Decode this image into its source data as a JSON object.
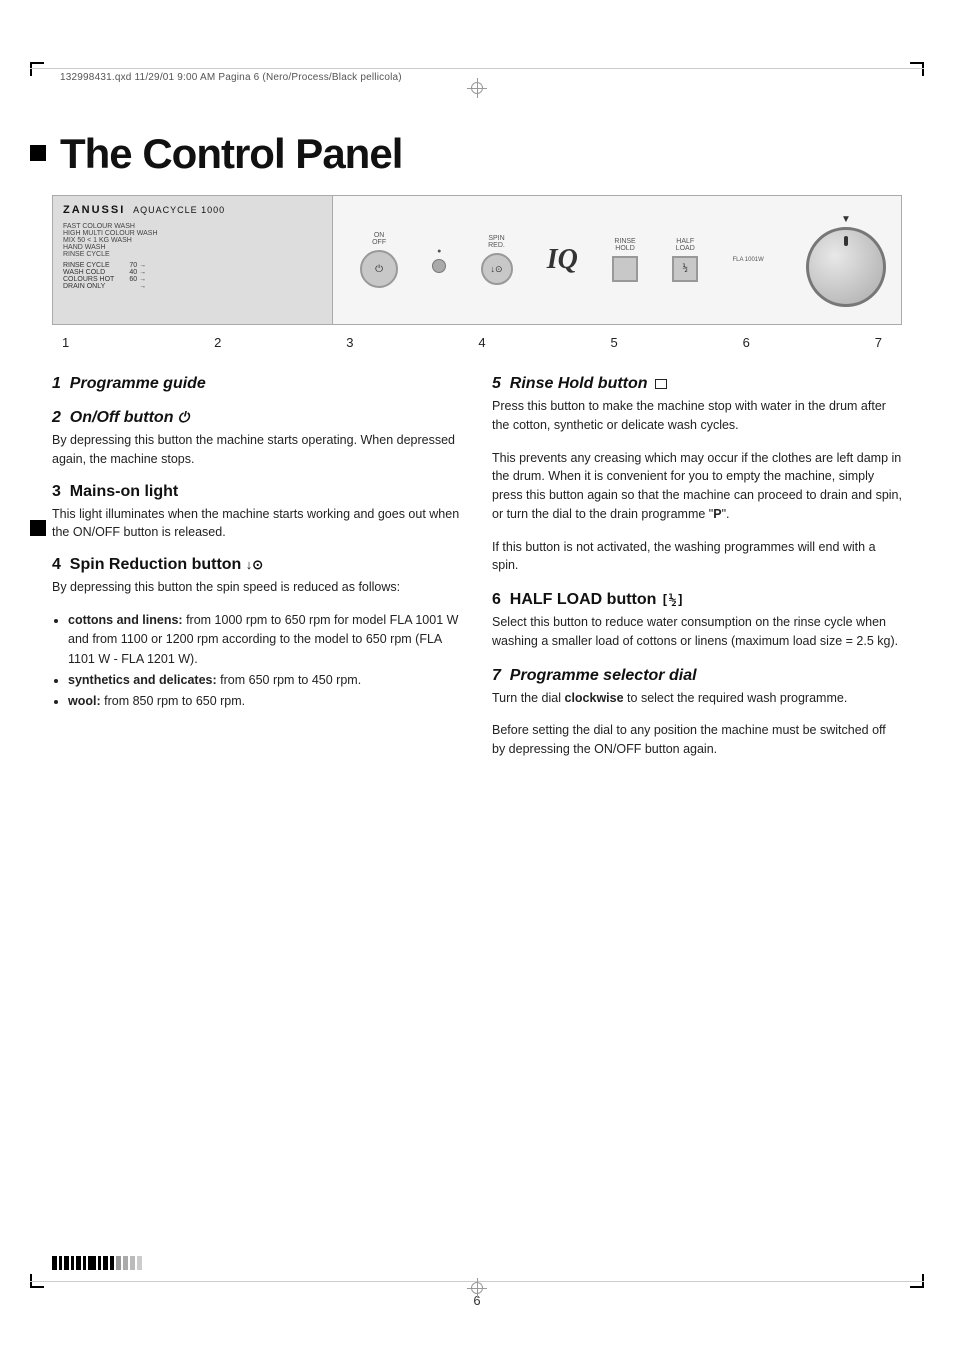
{
  "meta": {
    "file_info": "132998431.qxd  11/29/01  9:00 AM  Pagina 6  (Nero/Process/Black pellicola)"
  },
  "page": {
    "title": "The Control Panel",
    "number": "6"
  },
  "panel": {
    "brand": "ZANUSSI",
    "model": "AQUACYCLE 1000",
    "number_labels": [
      "1",
      "2",
      "3",
      "4",
      "5",
      "6",
      "7"
    ]
  },
  "sections": {
    "s1": {
      "number": "1",
      "title": "Programme guide",
      "style": "italic"
    },
    "s2": {
      "number": "2",
      "title": "On/Off button",
      "icon": "⏻",
      "body": "By depressing this button the machine starts operating. When depressed again, the machine stops."
    },
    "s3": {
      "number": "3",
      "title": "Mains-on light",
      "style": "bold",
      "body": "This light illuminates when the machine starts working and goes out when the ON/OFF button is released."
    },
    "s4": {
      "number": "4",
      "title": "Spin Reduction button",
      "icon": "↓⊙",
      "intro": "By depressing this button the spin speed is reduced as follows:",
      "bullets": [
        {
          "bold": "cottons and linens:",
          "text": " from 1000 rpm to 650 rpm for model FLA 1001 W and from 1100 or 1200 rpm according to the model to 650 rpm (FLA 1101 W - FLA 1201 W)."
        },
        {
          "bold": "synthetics and delicates:",
          "text": " from 650 rpm to 450 rpm."
        },
        {
          "bold": "wool:",
          "text": " from 850 rpm to 650 rpm."
        }
      ]
    },
    "s5": {
      "number": "5",
      "title": "Rinse Hold button",
      "icon": "□",
      "body1": "Press this button to make the machine stop with water in the drum after the cotton, synthetic or delicate wash cycles.",
      "body2": "This prevents any creasing which may occur if the clothes are left damp in the drum. When it is convenient for you to empty the machine, simply press this button again so that the machine can proceed to drain and spin, or turn the dial to the drain programme \"P\".",
      "body3": "If this button is not activated, the washing programmes will end with a spin."
    },
    "s6": {
      "number": "6",
      "title": "HALF LOAD button",
      "icon": "[½]",
      "body": "Select this button to reduce water consumption on the rinse cycle when washing a smaller load of cottons or linens  (maximum load size = 2.5 kg)."
    },
    "s7": {
      "number": "7",
      "title": "Programme selector dial",
      "body1": "Turn the dial clockwise to select the required wash programme.",
      "body2": "Before setting the dial to any position the machine must be switched off by depressing the ON/OFF button again.",
      "clockwise_bold": "clockwise"
    }
  }
}
